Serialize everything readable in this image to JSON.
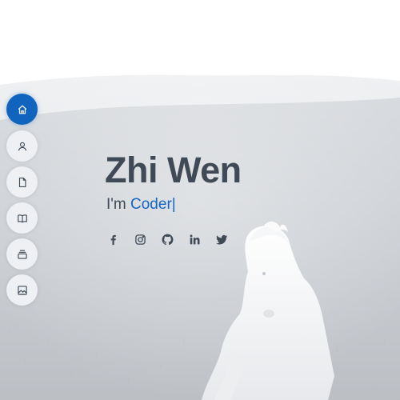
{
  "hero": {
    "name": "Zhi Wen",
    "prefix": "I'm ",
    "typed_text": "Coder",
    "cursor": "|"
  },
  "nav": {
    "items": [
      {
        "id": "home",
        "icon": "home-icon",
        "active": true
      },
      {
        "id": "about",
        "icon": "person-icon",
        "active": false
      },
      {
        "id": "resume",
        "icon": "file-icon",
        "active": false
      },
      {
        "id": "portfolio",
        "icon": "book-icon",
        "active": false
      },
      {
        "id": "services",
        "icon": "stack-icon",
        "active": false
      },
      {
        "id": "contact",
        "icon": "image-icon",
        "active": false
      }
    ]
  },
  "social": [
    "facebook-icon",
    "instagram-icon",
    "github-icon",
    "linkedin-icon",
    "twitter-icon"
  ],
  "colors": {
    "accent": "#1164bd",
    "text": "#3f4a56",
    "nav_bg": "#eef0f3"
  }
}
